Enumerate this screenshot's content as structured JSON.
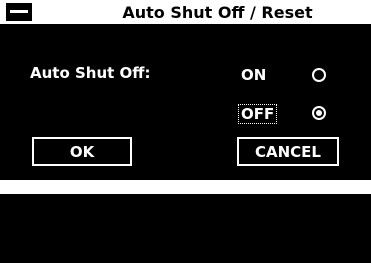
{
  "dialog": {
    "title": "Auto Shut Off / Reset",
    "field_label": "Auto Shut Off:",
    "options": [
      {
        "label": "ON",
        "selected": false
      },
      {
        "label": "OFF",
        "selected": true
      }
    ],
    "ok_label": "OK",
    "cancel_label": "CANCEL"
  },
  "colors": {
    "background": "#000000",
    "foreground": "#ffffff"
  }
}
